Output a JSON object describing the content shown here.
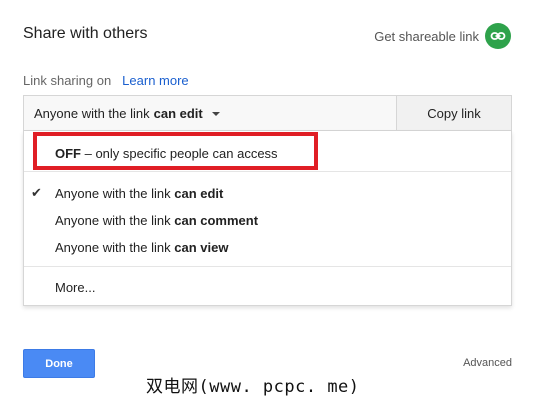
{
  "dialog": {
    "title": "Share with others",
    "shareable_link_label": "Get shareable link",
    "link_icon_color": "#2ea24b"
  },
  "link_sharing": {
    "status": "Link sharing on",
    "learn_more": "Learn more"
  },
  "access_select": {
    "prefix": "Anyone with the link",
    "selected": "can edit",
    "copy_button": "Copy link"
  },
  "menu": {
    "off_option": {
      "bold": "OFF",
      "rest": " – only specific people can access"
    },
    "options": [
      {
        "prefix": "Anyone with the link",
        "bold": "can edit",
        "checked": true
      },
      {
        "prefix": "Anyone with the link",
        "bold": "can comment",
        "checked": false
      },
      {
        "prefix": "Anyone with the link",
        "bold": "can view",
        "checked": false
      }
    ],
    "more": "More..."
  },
  "footer": {
    "done": "Done",
    "advanced": "Advanced"
  },
  "watermark": "双电网(www. pcpc. me)",
  "colors": {
    "accent_blue": "#4a8af4",
    "highlight_red": "#e01e25",
    "link_blue": "#1a5fcf"
  }
}
